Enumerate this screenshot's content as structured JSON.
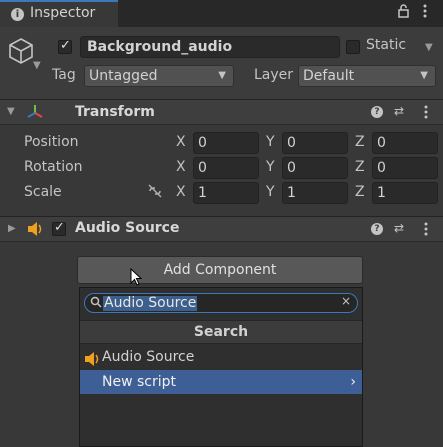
{
  "tab": {
    "title": "Inspector",
    "info_icon": "i"
  },
  "toolbar": {
    "lock_icon": "lock-icon",
    "more_icon": "kebab-menu-icon"
  },
  "object": {
    "name": "Background_audio",
    "static_label": "Static",
    "tag_label": "Tag",
    "tag_value": "Untagged",
    "layer_label": "Layer",
    "layer_value": "Default"
  },
  "transform": {
    "title": "Transform",
    "rows": [
      {
        "label": "Position",
        "x": "0",
        "y": "0",
        "z": "0"
      },
      {
        "label": "Rotation",
        "x": "0",
        "y": "0",
        "z": "0"
      },
      {
        "label": "Scale",
        "x": "1",
        "y": "1",
        "z": "1"
      }
    ],
    "axis": {
      "x": "X",
      "y": "Y",
      "z": "Z"
    }
  },
  "audio_source": {
    "title": "Audio Source"
  },
  "add_component": {
    "button_label": "Add Component",
    "search_value": "Audio Source",
    "section_title": "Search",
    "results": [
      "Audio Source",
      "New script"
    ]
  },
  "colors": {
    "accent": "#3a79bb",
    "highlight": "#3e5f96",
    "speaker": "#f0a020"
  }
}
